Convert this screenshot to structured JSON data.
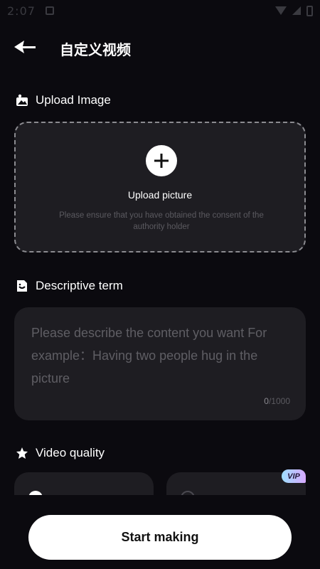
{
  "status_bar": {
    "time": "2:07"
  },
  "header": {
    "title": "自定义视频"
  },
  "upload_section": {
    "label": "Upload Image",
    "button_label": "Upload picture",
    "note": "Please ensure that you have obtained the consent of the authority holder"
  },
  "description_section": {
    "label": "Descriptive term",
    "placeholder": "Please describe the content you want For example：Having two people hug in the picture",
    "value": "",
    "count_current": "0",
    "count_max": "/1000"
  },
  "quality_section": {
    "label": "Video quality",
    "options": [
      {
        "selected": true,
        "vip": false
      },
      {
        "selected": false,
        "vip": true,
        "badge": "VIP"
      }
    ]
  },
  "footer": {
    "start_label": "Start making"
  },
  "colors": {
    "background": "#0b0a0f",
    "card": "#1e1d22",
    "accent": "#ffffff"
  }
}
